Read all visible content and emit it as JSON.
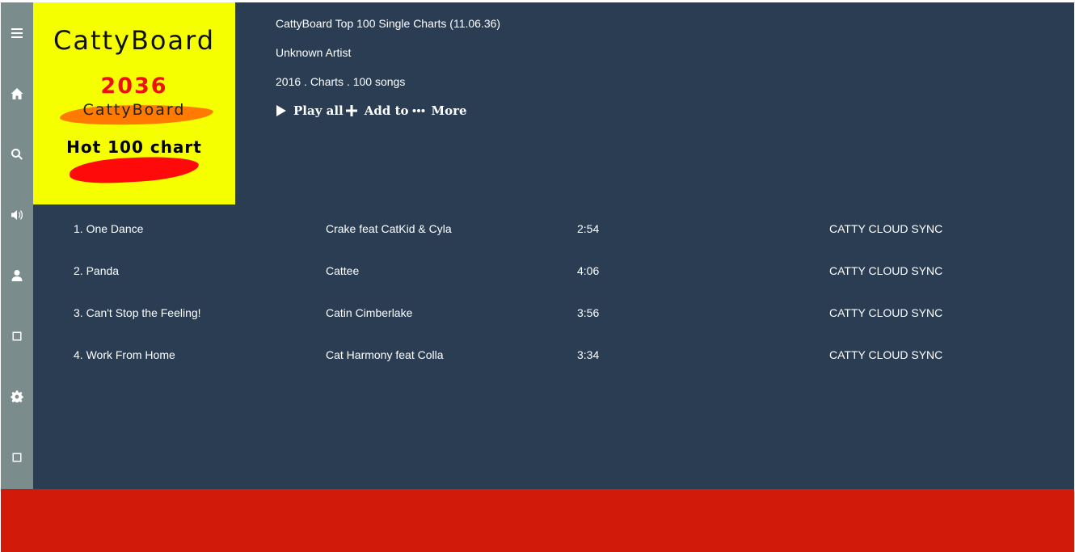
{
  "sidebar": {
    "items": [
      {
        "icon": "menu-icon",
        "label": "Menu"
      },
      {
        "icon": "home-icon",
        "label": "Home"
      },
      {
        "icon": "search-icon",
        "label": "Search"
      },
      {
        "icon": "volume-icon",
        "label": "Volume"
      },
      {
        "icon": "user-icon",
        "label": "User"
      },
      {
        "icon": "square-icon",
        "label": ""
      },
      {
        "icon": "gear-icon",
        "label": "Settings"
      },
      {
        "icon": "square-icon",
        "label": ""
      }
    ]
  },
  "cover": {
    "brand": "CattyBoard",
    "year": "2036",
    "subtitle": "CattyBoard",
    "chart_name": "Hot 100 chart",
    "background_color": "#f5ff00"
  },
  "album": {
    "title": "CattyBoard Top 100 Single Charts (11.06.36)",
    "artist": "Unknown Artist",
    "meta": "2016 . Charts . 100 songs"
  },
  "actions": {
    "play_all": "Play all",
    "add_to": "Add to",
    "more": "More"
  },
  "tracks": [
    {
      "title": "1. One Dance",
      "artist": "Crake feat CatKid & Cyla",
      "duration": "2:54",
      "source": "CATTY CLOUD SYNC"
    },
    {
      "title": "2. Panda",
      "artist": "Cattee",
      "duration": "4:06",
      "source": "CATTY CLOUD SYNC"
    },
    {
      "title": "3. Can't Stop the Feeling!",
      "artist": "Catin Cimberlake",
      "duration": "3:56",
      "source": "CATTY CLOUD SYNC"
    },
    {
      "title": "4. Work From Home",
      "artist": "Cat Harmony feat Colla",
      "duration": "3:34",
      "source": "CATTY CLOUD SYNC"
    }
  ],
  "colors": {
    "main_bg": "#2a3d53",
    "sidebar_bg": "#7a8c8c",
    "player_bg": "#d11a0a"
  }
}
